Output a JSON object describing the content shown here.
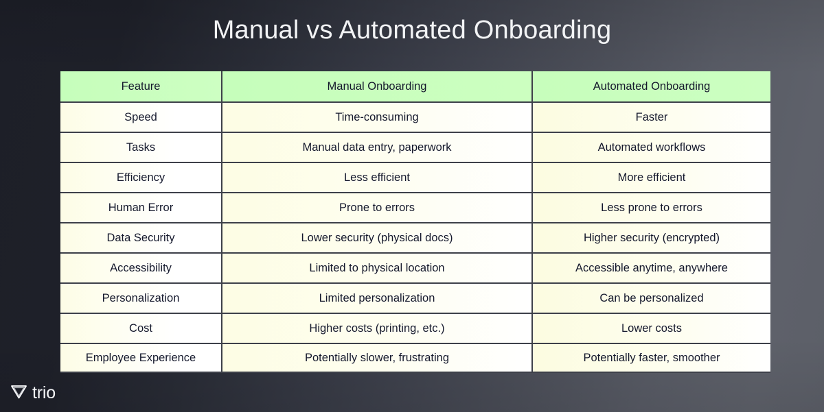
{
  "slide": {
    "title": "Manual vs Automated Onboarding",
    "background_left": "#1e2029",
    "background_right": "#5c5f68",
    "header_bg": "#c9ffbb",
    "cell_bg": "#fdfde4",
    "border_color": "#3d4049",
    "text_color": "#14182c"
  },
  "table": {
    "headers": [
      "Feature",
      "Manual Onboarding",
      "Automated Onboarding"
    ],
    "rows": [
      [
        "Speed",
        "Time-consuming",
        "Faster"
      ],
      [
        "Tasks",
        "Manual data entry, paperwork",
        "Automated workflows"
      ],
      [
        "Efficiency",
        "Less efficient",
        "More efficient"
      ],
      [
        "Human Error",
        "Prone to errors",
        "Less prone to errors"
      ],
      [
        "Data Security",
        "Lower security (physical docs)",
        "Higher security (encrypted)"
      ],
      [
        "Accessibility",
        "Limited to physical location",
        "Accessible anytime, anywhere"
      ],
      [
        "Personalization",
        "Limited personalization",
        "Can be personalized"
      ],
      [
        "Cost",
        "Higher costs (printing, etc.)",
        "Lower costs"
      ],
      [
        "Employee Experience",
        "Potentially slower, frustrating",
        "Potentially faster, smoother"
      ]
    ]
  },
  "logo": {
    "text": "trio",
    "mark": "triangle-down-icon",
    "color": "#f4f5f7"
  }
}
